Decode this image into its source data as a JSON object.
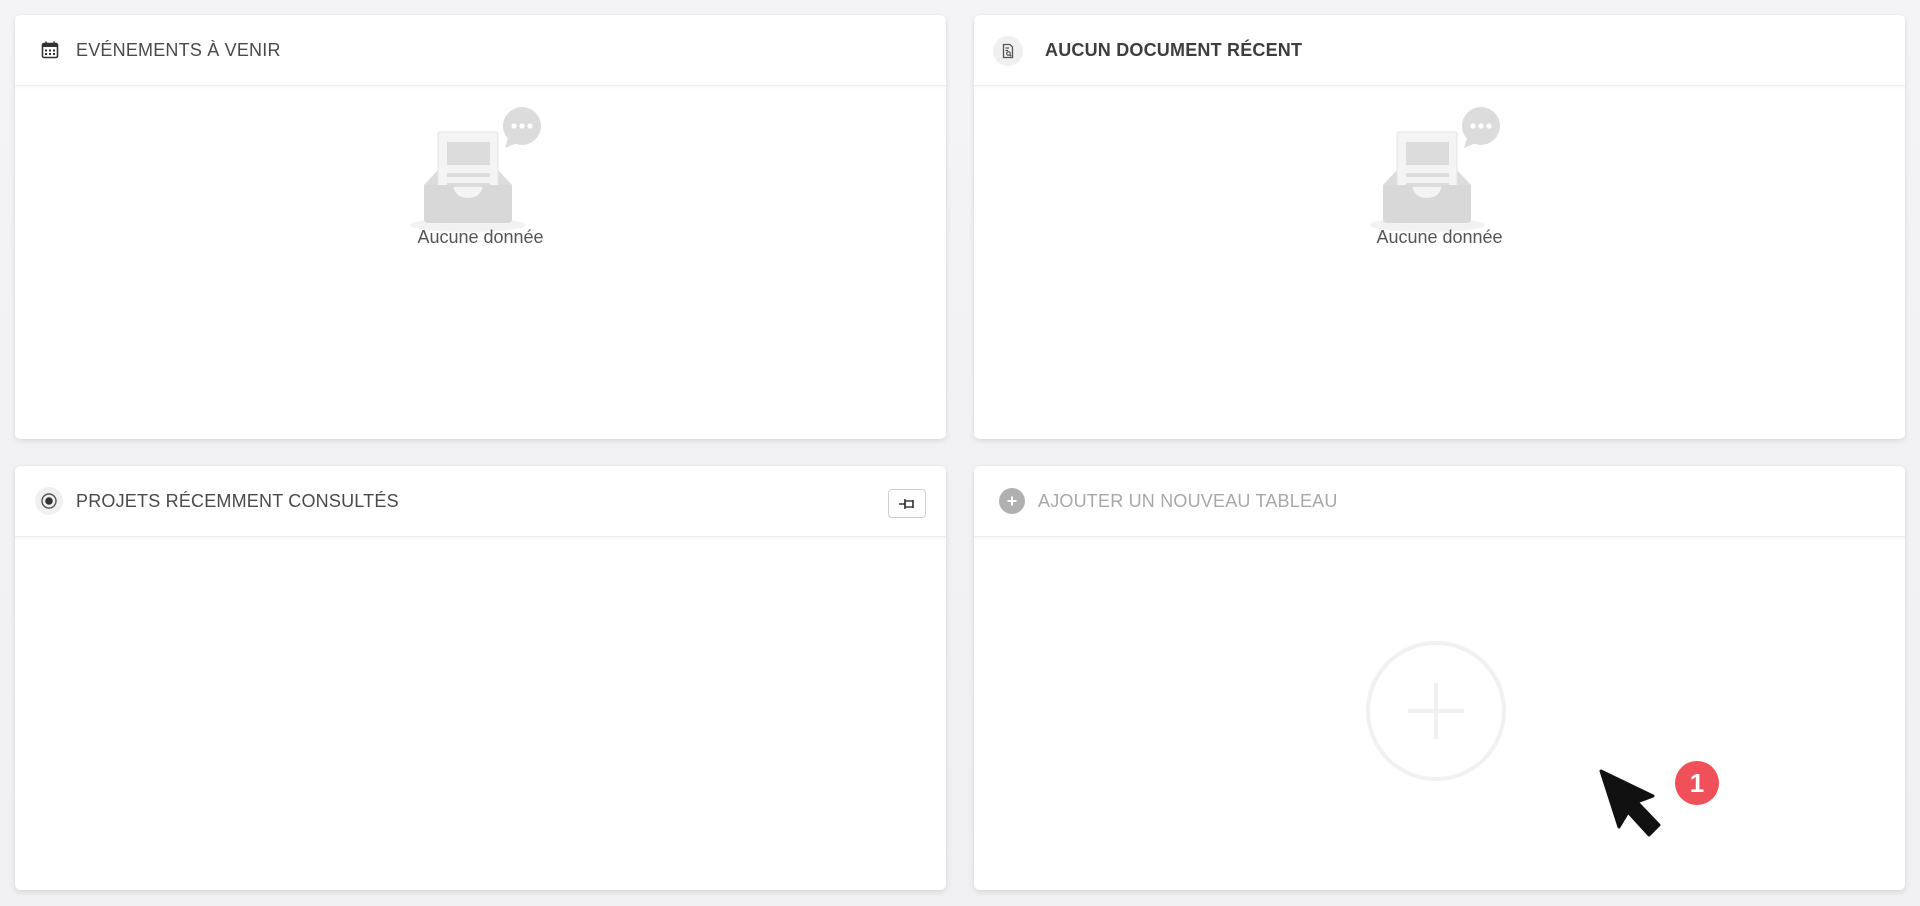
{
  "colors": {
    "background": "#f2f2f4",
    "panel": "#ffffff",
    "title_text": "#4a4a4a",
    "muted_text": "#a8a8a8",
    "badge": "#f0505a",
    "cursor": "#111111"
  },
  "panels": {
    "upcoming_events": {
      "title": "EVÉNEMENTS À VENIR",
      "icon": "calendar-icon",
      "empty_text": "Aucune donnée",
      "empty_icon": "empty-inbox-icon"
    },
    "recent_documents": {
      "title": "AUCUN DOCUMENT RÉCENT",
      "icon": "document-search-icon",
      "empty_text": "Aucune donnée",
      "empty_icon": "empty-inbox-icon"
    },
    "recent_projects": {
      "title": "PROJETS RÉCEMMENT CONSULTÉS",
      "icon": "target-icon",
      "action_icon": "pin-icon"
    },
    "add_board": {
      "title": "AJOUTER UN NOUVEAU TABLEAU",
      "icon": "plus-circle-icon",
      "center_icon": "large-plus-icon"
    }
  },
  "annotation": {
    "badge_number": "1",
    "pointer": "cursor-arrow-icon"
  }
}
